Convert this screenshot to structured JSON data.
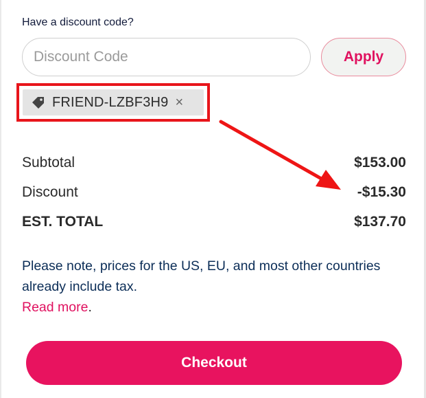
{
  "discount": {
    "prompt": "Have a discount code?",
    "placeholder": "Discount Code",
    "apply_label": "Apply",
    "applied_code": "FRIEND-LZBF3H9",
    "remove_glyph": "×"
  },
  "summary": {
    "subtotal_label": "Subtotal",
    "subtotal_value": "$153.00",
    "discount_label": "Discount",
    "discount_value": "-$15.30",
    "total_label": "EST. TOTAL",
    "total_value": "$137.70"
  },
  "note": {
    "text": "Please note, prices for the US, EU, and most other countries already include tax.",
    "link_label": "Read more",
    "trailing": "."
  },
  "checkout_label": "Checkout",
  "colors": {
    "accent": "#e8135f",
    "highlight": "#e8151b",
    "note_text": "#0b2d57"
  },
  "icons": {
    "chip_icon": "tag-icon",
    "annotation": "arrow-annotation"
  }
}
